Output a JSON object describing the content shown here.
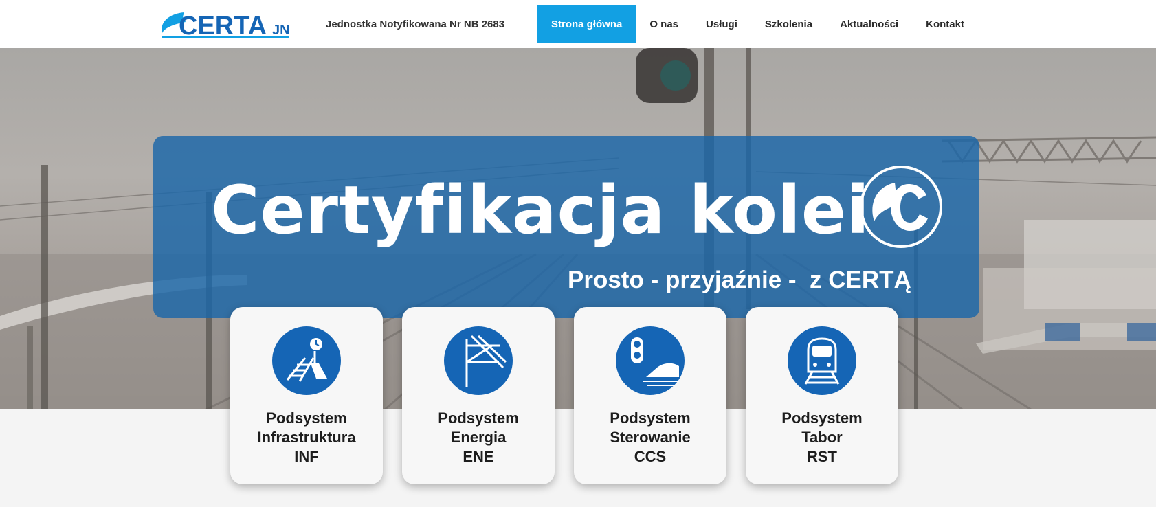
{
  "header": {
    "logo_text": "CERTA",
    "logo_suffix": "JN",
    "tagline": "Jednostka Notyfikowana Nr NB 2683",
    "nav": [
      {
        "label": "Strona główna",
        "active": true
      },
      {
        "label": "O nas",
        "active": false
      },
      {
        "label": "Usługi",
        "active": false
      },
      {
        "label": "Szkolenia",
        "active": false
      },
      {
        "label": "Aktualności",
        "active": false
      },
      {
        "label": "Kontakt",
        "active": false
      }
    ]
  },
  "hero": {
    "title": "Certyfikacja kolei",
    "subtitle": "Prosto - przyjaźnie -  z CERTĄ",
    "logo_icon": "cc-logo-icon"
  },
  "cards": [
    {
      "line1": "Podsystem",
      "line2": "Infrastruktura",
      "line3": "INF",
      "icon": "infrastructure-icon"
    },
    {
      "line1": "Podsystem",
      "line2": "Energia",
      "line3": "ENE",
      "icon": "energy-icon"
    },
    {
      "line1": "Podsystem",
      "line2": "Sterowanie",
      "line3": "CCS",
      "icon": "control-signal-icon"
    },
    {
      "line1": "Podsystem",
      "line2": "Tabor",
      "line3": "RST",
      "icon": "rolling-stock-icon"
    }
  ],
  "colors": {
    "accent": "#12a0e3",
    "brand_blue": "#1b66a8",
    "icon_blue": "#1565b5"
  }
}
